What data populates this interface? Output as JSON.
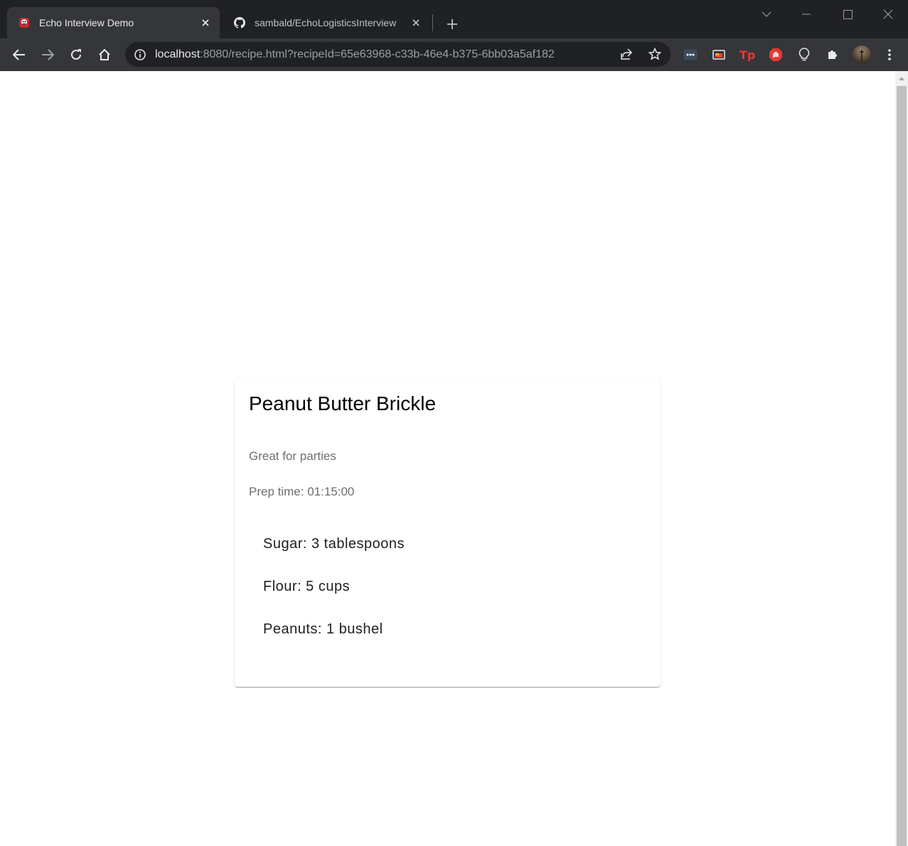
{
  "browser": {
    "tabs": [
      {
        "title": "Echo Interview Demo",
        "icon": "app-favicon-icon",
        "active": true
      },
      {
        "title": "sambald/EchoLogisticsInterview",
        "icon": "github-icon",
        "active": false
      }
    ],
    "address": {
      "host": "localhost",
      "rest": ":8080/recipe.html?recipeId=65e63968-c33b-46e4-b375-6bb03a5af182"
    },
    "colors": {
      "tabstrip": "#202124",
      "toolbar": "#35363a",
      "omnibox": "#202124",
      "text_active": "#e8eaed",
      "text_muted": "#9aa0a6"
    }
  },
  "recipe": {
    "name": "Peanut Butter Brickle",
    "description": "Great for parties",
    "prep_time": "Prep time: 01:15:00",
    "ingredients": [
      {
        "text": "Sugar: 3 tablespoons"
      },
      {
        "text": "Flour: 5 cups"
      },
      {
        "text": "Peanuts: 1 bushel"
      }
    ]
  }
}
